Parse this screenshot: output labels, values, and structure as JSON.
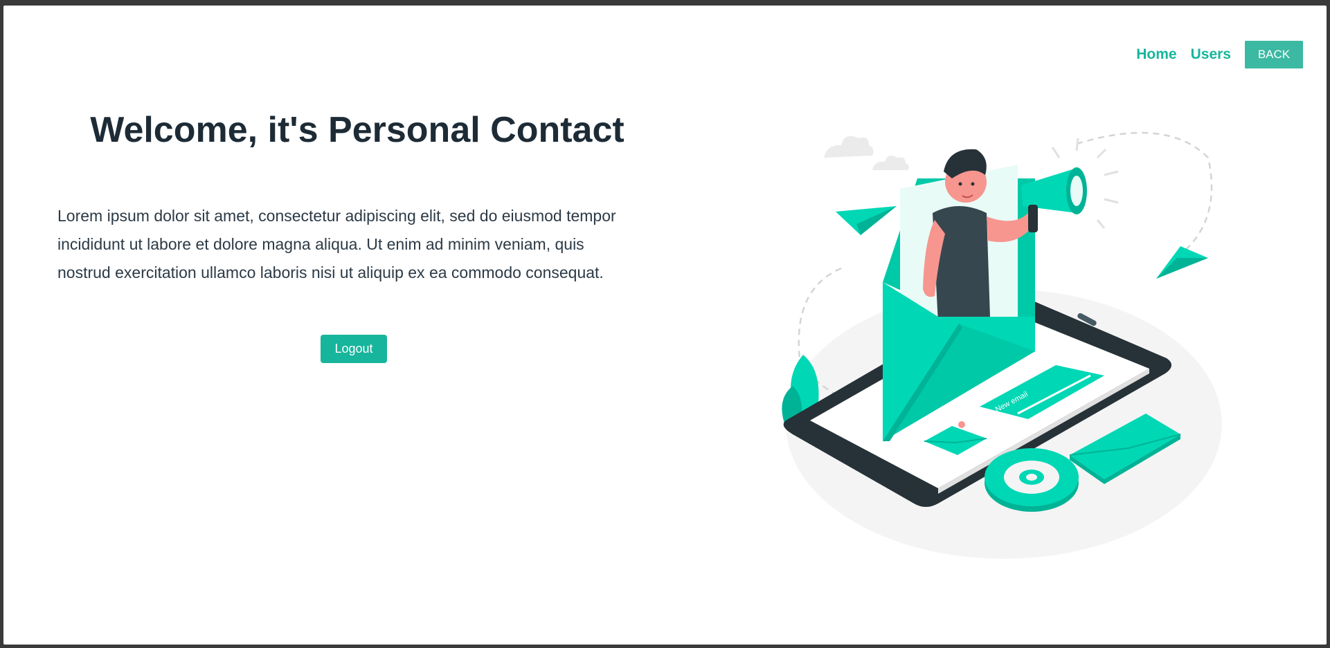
{
  "nav": {
    "home_label": "Home",
    "users_label": "Users",
    "back_label": "BACK"
  },
  "main": {
    "title": "Welcome, it's Personal Contact",
    "body_lines": [
      "Lorem ipsum dolor sit amet, consectetur adipiscing elit, sed do eiusmod tempor",
      "incididunt ut labore et dolore magna aliqua. Ut enim ad minim veniam, quis",
      "nostrud exercitation ullamco laboris nisi ut aliquip ex ea commodo consequat."
    ],
    "logout_label": "Logout"
  },
  "illustration": {
    "badge_text": "New email",
    "icons": [
      "person-icon",
      "megaphone-icon",
      "envelope-icon",
      "tablet-icon",
      "at-sign-icon",
      "paper-plane-icon",
      "cloud-icon",
      "leaf-icon"
    ]
  },
  "colors": {
    "accent": "#17b59b",
    "teal": "#00d7b5",
    "dark": "#1d2b36",
    "back_button": "#3bb9a2"
  }
}
